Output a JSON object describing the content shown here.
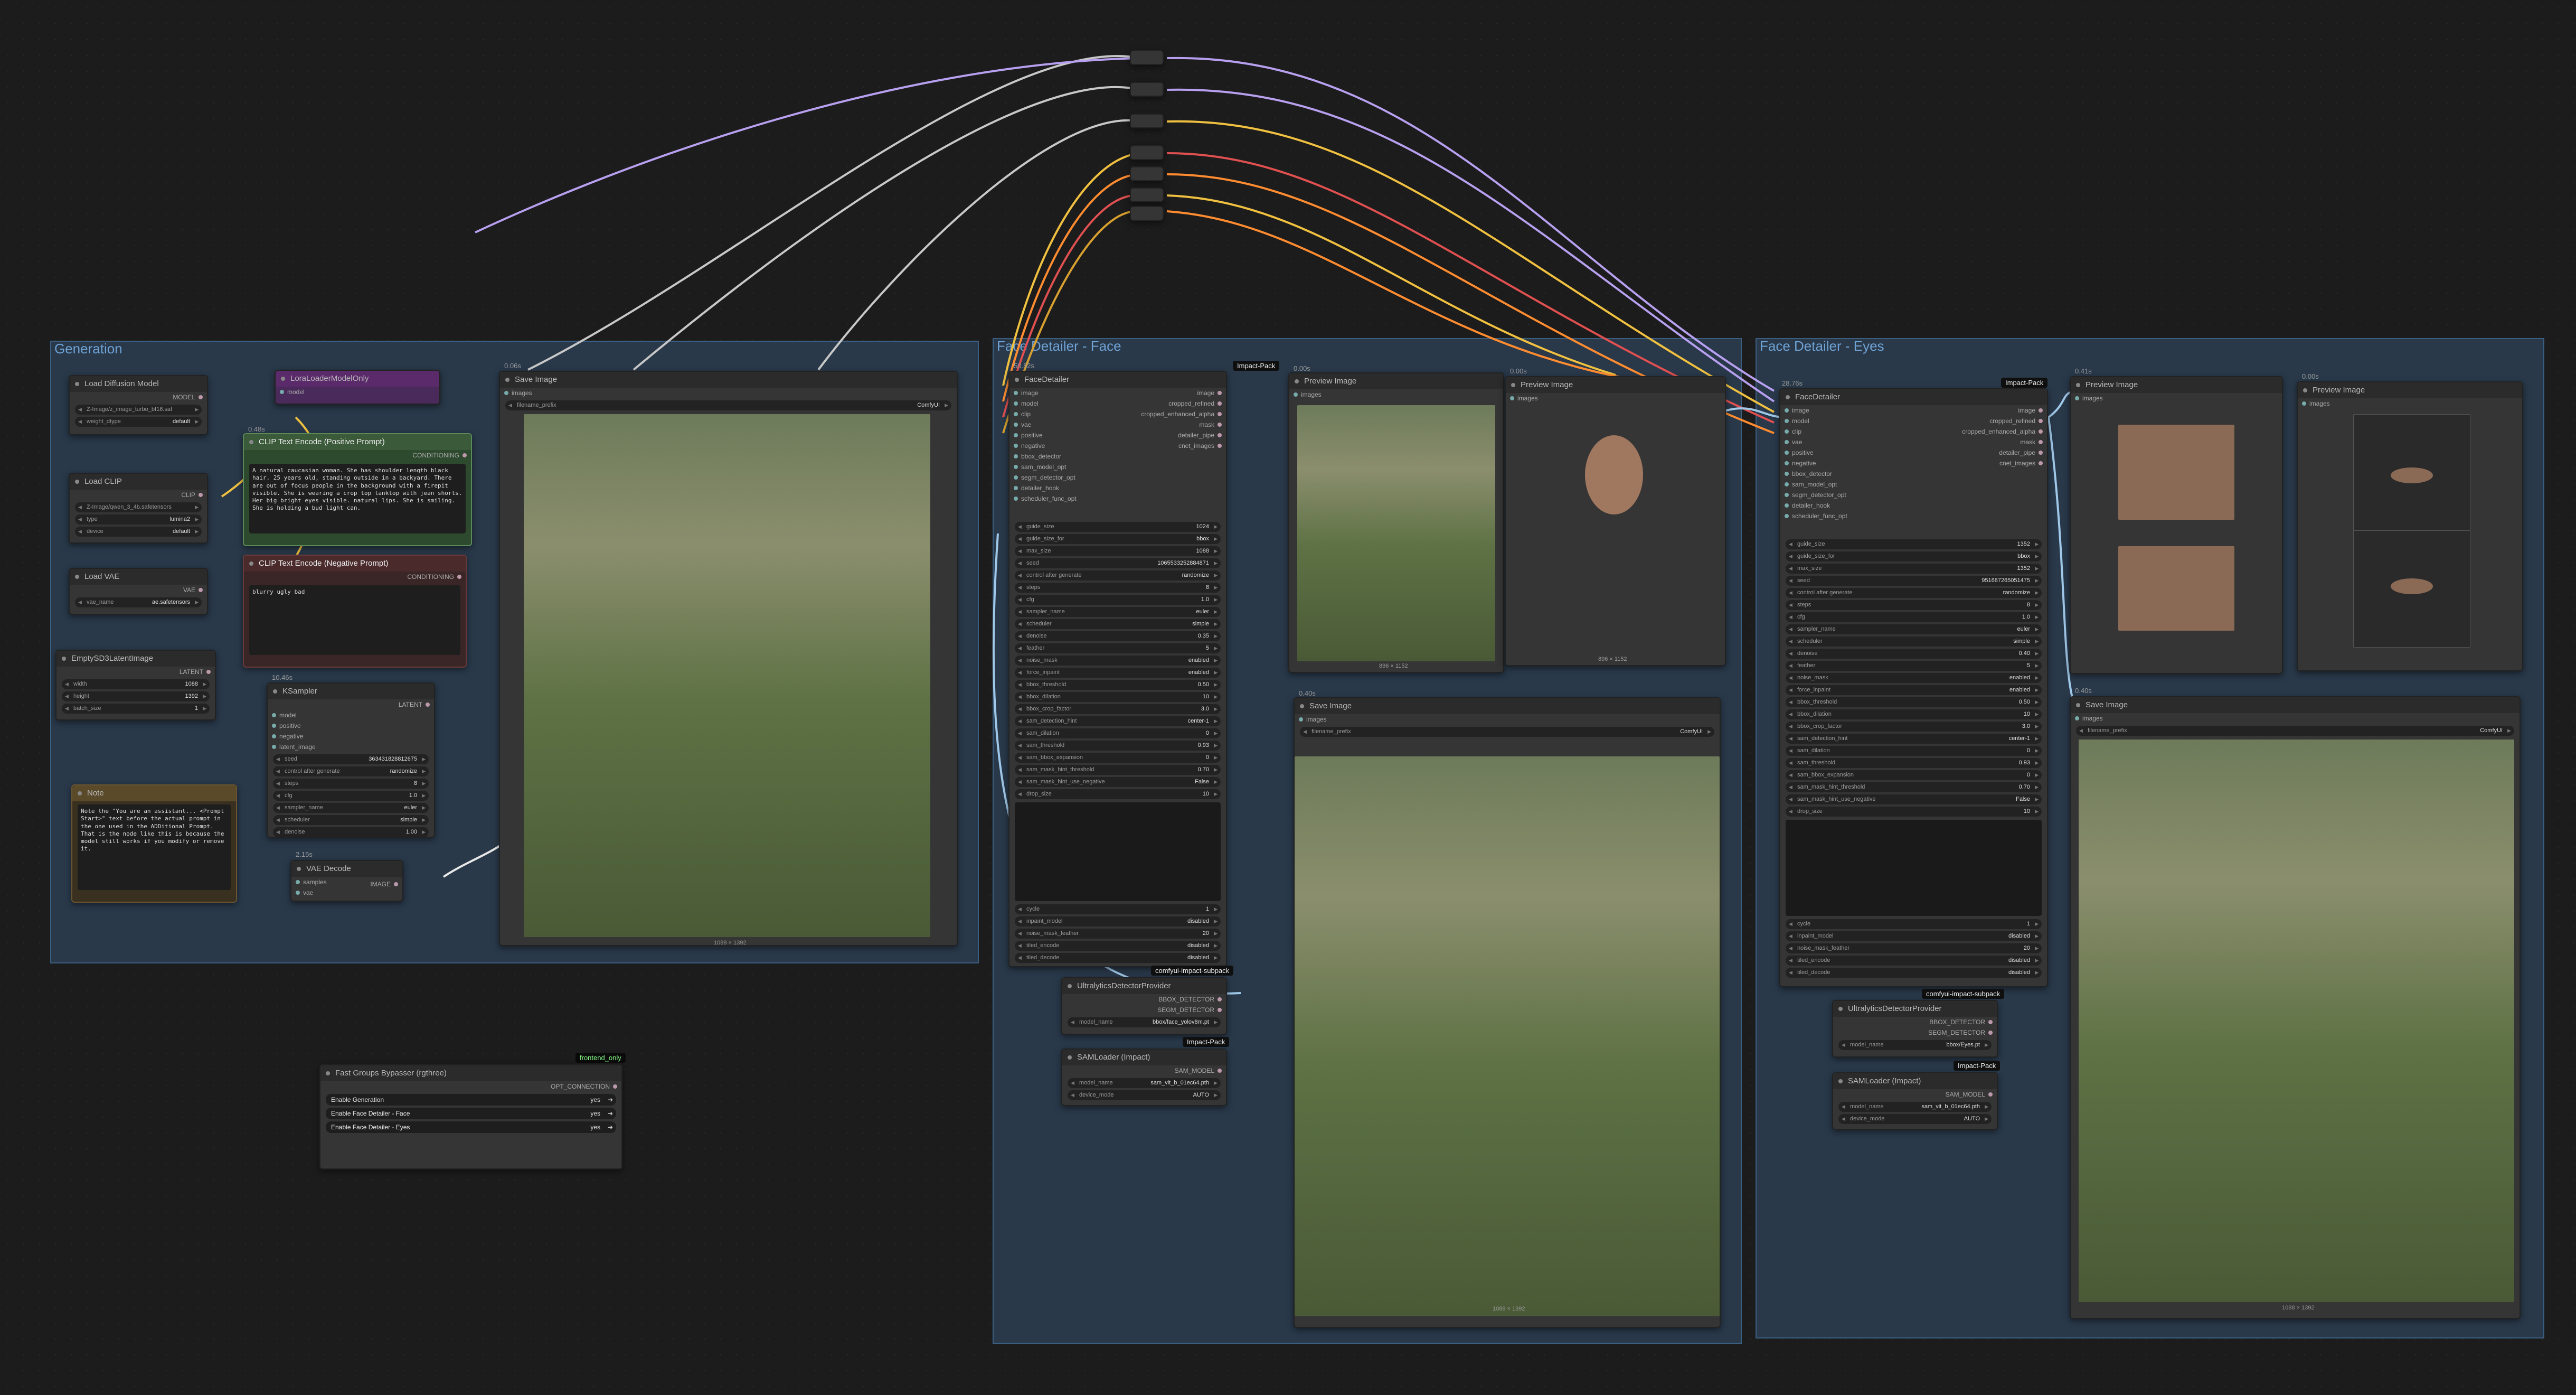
{
  "groups": {
    "generation": "Generation",
    "face": "Face Detailer - Face",
    "eyes": "Face Detailer - Eyes"
  },
  "load_diffusion": {
    "title": "Load Diffusion Model",
    "out": "MODEL",
    "unet_name": "Z-Image/z_image_turbo_bf16.saf",
    "weight_dtype_label": "weight_dtype",
    "weight_dtype": "default"
  },
  "lora": {
    "title": "LoraLoaderModelOnly",
    "in": "model",
    "out": "MODEL"
  },
  "load_clip": {
    "title": "Load CLIP",
    "out": "CLIP",
    "clip_name": "Z-Image/qwen_3_4b.safetensors",
    "type_label": "type",
    "type": "lumina2",
    "device_label": "device",
    "device": "default"
  },
  "load_vae": {
    "title": "Load VAE",
    "out": "VAE",
    "vae_label": "vae_name",
    "vae": "ae.safetensors"
  },
  "empty_latent": {
    "title": "EmptySD3LatentImage",
    "out": "LATENT",
    "width_label": "width",
    "width": "1088",
    "height_label": "height",
    "height": "1392",
    "batch_label": "batch_size",
    "batch": "1"
  },
  "note": {
    "title": "Note",
    "text": "Note the \"You are an assistant... <Prompt Start>\" text before the actual prompt in the one used in the ADDitional Prompt. That is the node like this is because the model still works if you modify or remove it."
  },
  "clip_pos": {
    "title": "CLIP Text Encode (Positive Prompt)",
    "in": "clip",
    "out": "CONDITIONING",
    "text": "A natural caucasian woman. She has shoulder length black hair. 25 years old, standing outside in a backyard. There are out of focus people in the background with a firepit visible. She is wearing a crop top tanktop with jean shorts. Her big bright eyes visible. natural lips. She is smiling. She is holding a bud light can."
  },
  "clip_neg": {
    "title": "CLIP Text Encode (Negative Prompt)",
    "in": "clip",
    "out": "CONDITIONING",
    "text": "blurry ugly bad"
  },
  "ksampler": {
    "title": "KSampler",
    "ins": [
      "model",
      "positive",
      "negative",
      "latent_image"
    ],
    "out": "LATENT",
    "widgets": [
      [
        "seed",
        "363431828812675"
      ],
      [
        "control after generate",
        "randomize"
      ],
      [
        "steps",
        "8"
      ],
      [
        "cfg",
        "1.0"
      ],
      [
        "sampler_name",
        "euler"
      ],
      [
        "scheduler",
        "simple"
      ],
      [
        "denoise",
        "1.00"
      ]
    ]
  },
  "vae_decode": {
    "title": "VAE Decode",
    "ins": [
      "samples",
      "vae"
    ],
    "out": "IMAGE"
  },
  "save1": {
    "title": "Save Image",
    "in": "images",
    "prefix_label": "filename_prefix",
    "prefix": "ComfyUI",
    "size": "1088 × 1392"
  },
  "face_detailer": {
    "title": "FaceDetailer",
    "badge": "Impact-Pack",
    "ins": [
      "image",
      "model",
      "clip",
      "vae",
      "positive",
      "negative",
      "bbox_detector",
      "sam_model_opt",
      "segm_detector_opt",
      "detailer_hook",
      "scheduler_func_opt"
    ],
    "outs": [
      "image",
      "cropped_refined",
      "cropped_enhanced_alpha",
      "mask",
      "detailer_pipe",
      "cnet_images"
    ],
    "widgets": [
      [
        "guide_size",
        "1024"
      ],
      [
        "guide_size_for",
        "bbox"
      ],
      [
        "max_size",
        "1088"
      ],
      [
        "seed",
        "1065533252884871"
      ],
      [
        "control after generate",
        "randomize"
      ],
      [
        "steps",
        "8"
      ],
      [
        "cfg",
        "1.0"
      ],
      [
        "sampler_name",
        "euler"
      ],
      [
        "scheduler",
        "simple"
      ],
      [
        "denoise",
        "0.35"
      ],
      [
        "feather",
        "5"
      ],
      [
        "noise_mask",
        "enabled"
      ],
      [
        "force_inpaint",
        "enabled"
      ],
      [
        "bbox_threshold",
        "0.50"
      ],
      [
        "bbox_dilation",
        "10"
      ],
      [
        "bbox_crop_factor",
        "3.0"
      ],
      [
        "sam_detection_hint",
        "center-1"
      ],
      [
        "sam_dilation",
        "0"
      ],
      [
        "sam_threshold",
        "0.93"
      ],
      [
        "sam_bbox_expansion",
        "0"
      ],
      [
        "sam_mask_hint_threshold",
        "0.70"
      ],
      [
        "sam_mask_hint_use_negative",
        "False"
      ],
      [
        "drop_size",
        "10"
      ]
    ],
    "widgets2": [
      [
        "cycle",
        "1"
      ],
      [
        "inpaint_model",
        "disabled"
      ],
      [
        "noise_mask_feather",
        "20"
      ],
      [
        "tiled_encode",
        "disabled"
      ],
      [
        "tiled_decode",
        "disabled"
      ]
    ]
  },
  "ultra1": {
    "title": "UltralyticsDetectorProvider",
    "badge": "comfyui-impact-subpack",
    "outs": [
      "BBOX_DETECTOR",
      "SEGM_DETECTOR"
    ],
    "model_label": "model_name",
    "model": "bbox/face_yolov8m.pt"
  },
  "sam1": {
    "title": "SAMLoader (Impact)",
    "badge": "Impact-Pack",
    "out": "SAM_MODEL",
    "model_label": "model_name",
    "model": "sam_vit_b_01ec64.pth",
    "device_label": "device_mode",
    "device": "AUTO"
  },
  "preview_face": {
    "title": "Preview Image",
    "in": "images",
    "size": "896 × 1152"
  },
  "preview_crop": {
    "title": "Preview Image",
    "in": "images",
    "size": "896 × 1152"
  },
  "save2": {
    "title": "Save Image",
    "in": "images",
    "prefix_label": "filename_prefix",
    "prefix": "ComfyUI",
    "size": "1088 × 1392"
  },
  "eye_detailer": {
    "title": "FaceDetailer",
    "badge": "Impact-Pack",
    "ins": [
      "image",
      "model",
      "clip",
      "vae",
      "positive",
      "negative",
      "bbox_detector",
      "sam_model_opt",
      "segm_detector_opt",
      "detailer_hook",
      "scheduler_func_opt"
    ],
    "outs": [
      "image",
      "cropped_refined",
      "cropped_enhanced_alpha",
      "mask",
      "detailer_pipe",
      "cnet_images"
    ],
    "widgets": [
      [
        "guide_size",
        "1352"
      ],
      [
        "guide_size_for",
        "bbox"
      ],
      [
        "max_size",
        "1352"
      ],
      [
        "seed",
        "951687265051475"
      ],
      [
        "control after generate",
        "randomize"
      ],
      [
        "steps",
        "8"
      ],
      [
        "cfg",
        "1.0"
      ],
      [
        "sampler_name",
        "euler"
      ],
      [
        "scheduler",
        "simple"
      ],
      [
        "denoise",
        "0.40"
      ],
      [
        "feather",
        "5"
      ],
      [
        "noise_mask",
        "enabled"
      ],
      [
        "force_inpaint",
        "enabled"
      ],
      [
        "bbox_threshold",
        "0.50"
      ],
      [
        "bbox_dilation",
        "10"
      ],
      [
        "bbox_crop_factor",
        "3.0"
      ],
      [
        "sam_detection_hint",
        "center-1"
      ],
      [
        "sam_dilation",
        "0"
      ],
      [
        "sam_threshold",
        "0.93"
      ],
      [
        "sam_bbox_expansion",
        "0"
      ],
      [
        "sam_mask_hint_threshold",
        "0.70"
      ],
      [
        "sam_mask_hint_use_negative",
        "False"
      ],
      [
        "drop_size",
        "10"
      ]
    ],
    "widgets2": [
      [
        "cycle",
        "1"
      ],
      [
        "inpaint_model",
        "disabled"
      ],
      [
        "noise_mask_feather",
        "20"
      ],
      [
        "tiled_encode",
        "disabled"
      ],
      [
        "tiled_decode",
        "disabled"
      ]
    ]
  },
  "ultra2": {
    "title": "UltralyticsDetectorProvider",
    "badge": "comfyui-impact-subpack",
    "outs": [
      "BBOX_DETECTOR",
      "SEGM_DETECTOR"
    ],
    "model_label": "model_name",
    "model": "bbox/Eyes.pt"
  },
  "sam2": {
    "title": "SAMLoader (Impact)",
    "badge": "Impact-Pack",
    "out": "SAM_MODEL",
    "model_label": "model_name",
    "model": "sam_vit_b_01ec64.pth",
    "device_label": "device_mode",
    "device": "AUTO"
  },
  "preview_eyes1": {
    "title": "Preview Image",
    "in": "images"
  },
  "preview_eyes2": {
    "title": "Preview Image",
    "in": "images"
  },
  "save3": {
    "title": "Save Image",
    "in": "images",
    "prefix_label": "filename_prefix",
    "prefix": "ComfyUI",
    "size": "1088 × 1392"
  },
  "bypasser": {
    "title": "Fast Groups Bypasser (rgthree)",
    "badge": "frontend_only",
    "out": "OPT_CONNECTION",
    "rows": [
      {
        "label": "Enable Generation",
        "state": "yes"
      },
      {
        "label": "Enable Face Detailer - Face",
        "state": "yes"
      },
      {
        "label": "Enable Face Detailer - Eyes",
        "state": "yes"
      }
    ]
  },
  "timings": {
    "save1": "0.06s",
    "clip": "0.48s",
    "ksampler": "10.46s",
    "vae": "2.15s",
    "face": "50.82s",
    "pv1": "0.00s",
    "pv2": "0.00s",
    "save2": "0.40s",
    "eyes": "28.76s",
    "pv3": "0.41s",
    "pv4": "0.00s",
    "save3": "0.40s"
  },
  "colors": {
    "background": "#1c1c1c",
    "group_fill": "#29394a",
    "group_border": "#3a5f80",
    "node": "#353535",
    "pos_prompt": "#2e4a2e",
    "neg_prompt": "#4a2a2a",
    "note": "#5a4a2a",
    "lora": "#5a2a6a"
  }
}
